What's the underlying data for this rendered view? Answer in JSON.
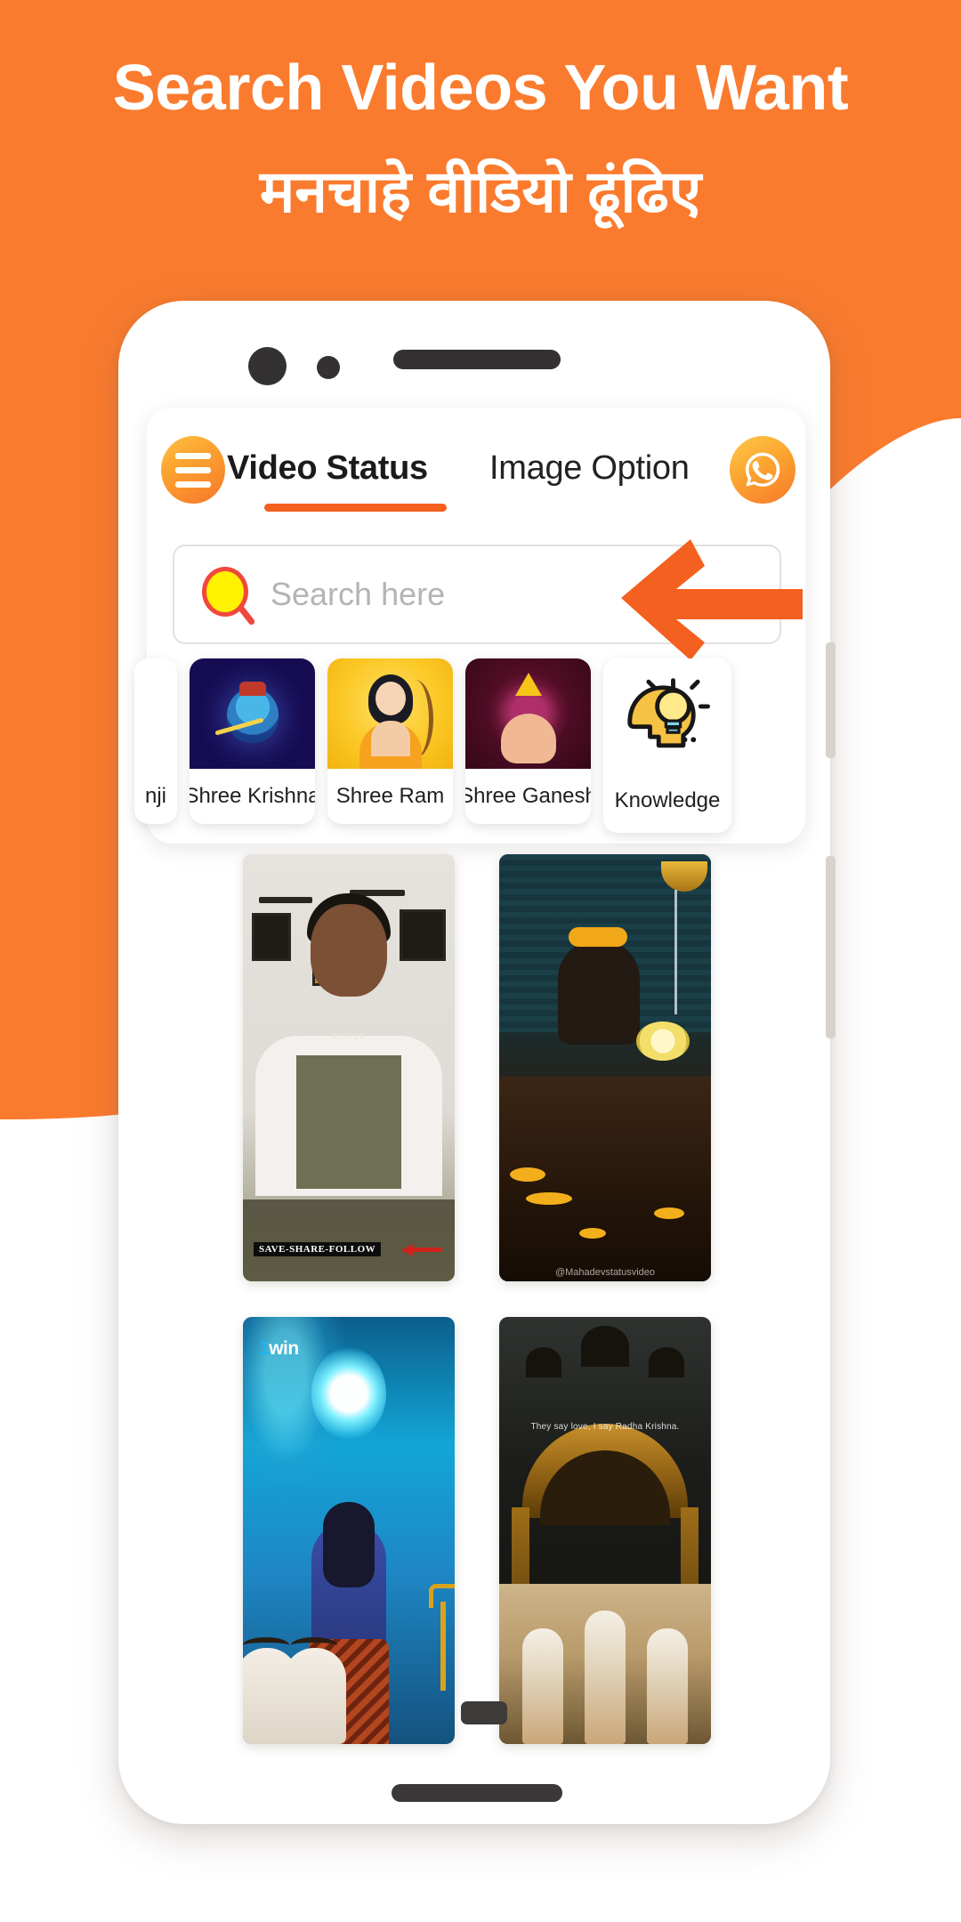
{
  "promo": {
    "headline_en": "Search Videos You Want",
    "headline_hi": "मनचाहे वीडियो ढूंढिए",
    "background_color": "#FA7B2E",
    "accent_color": "#F4601F"
  },
  "app": {
    "menu_icon": "hamburger-icon",
    "whatsapp_icon": "whatsapp-icon",
    "tabs": [
      {
        "label": "Video Status",
        "active": true
      },
      {
        "label": "Image Option",
        "active": false
      }
    ],
    "search": {
      "placeholder": "Search here",
      "value": "",
      "icon": "magnifier-icon"
    },
    "categories": [
      {
        "label": "nji",
        "partial": true
      },
      {
        "label": "Shree Krishna",
        "bg": "#160C52"
      },
      {
        "label": "Shree Ram",
        "bg": "#FBC825"
      },
      {
        "label": "Shree Ganesh",
        "bg": "#4A0C22"
      },
      {
        "label": "Knowledge",
        "bg": "#FFFFFF"
      }
    ],
    "videos": [
      {
        "id": "v1",
        "caption": "SAVE-SHARE-FOLLOW",
        "overlay_text": "POWER"
      },
      {
        "id": "v2",
        "watermark": "@Mahadevstatusvideo"
      },
      {
        "id": "v3",
        "watermark": "1win"
      },
      {
        "id": "v4",
        "caption": "They say love, I say Radha Krishna."
      }
    ]
  },
  "device": {
    "camera": "front-camera",
    "sensor": "proximity-sensor",
    "speaker": "earpiece-speaker",
    "home_indicator": "home-indicator"
  }
}
